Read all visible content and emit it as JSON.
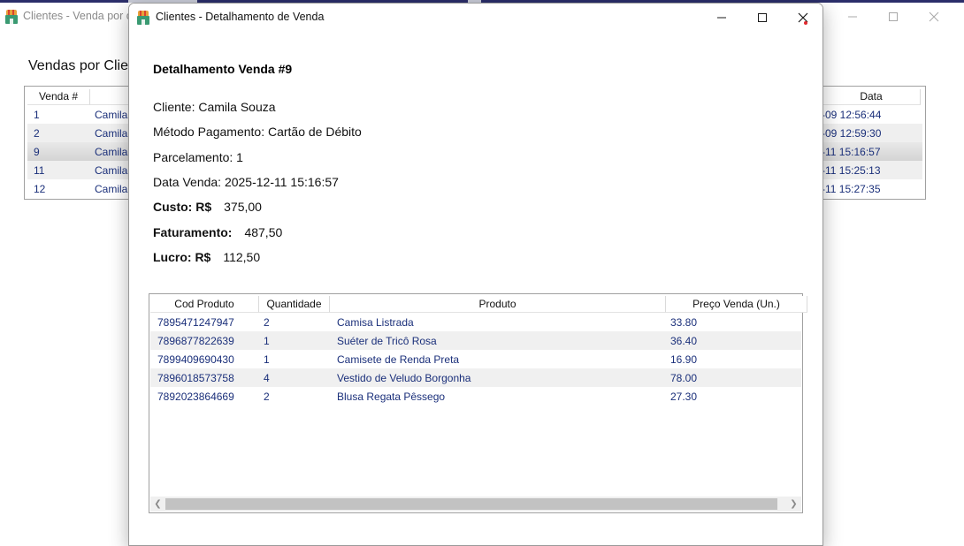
{
  "background_window": {
    "title": "Clientes - Venda por cl",
    "heading": "Vendas por Clier",
    "columns": [
      "Venda #",
      "Data"
    ],
    "rows": [
      {
        "id": "1",
        "client": "Camila",
        "date": "-09 12:56:44"
      },
      {
        "id": "2",
        "client": "Camila",
        "date": "-09 12:59:30"
      },
      {
        "id": "9",
        "client": "Camila",
        "date": "-11 15:16:57"
      },
      {
        "id": "11",
        "client": "Camila",
        "date": "-11 15:25:13"
      },
      {
        "id": "12",
        "client": "Camila",
        "date": "-11 15:27:35"
      }
    ],
    "selected_row": "9"
  },
  "dialog": {
    "title": "Clientes - Detalhamento de Venda",
    "heading": "Detalhamento Venda #9",
    "cliente": "Cliente: Camila Souza",
    "metodo": "Método Pagamento: Cartão de Débito",
    "parcelamento": "Parcelamento: 1",
    "data_venda": "Data Venda: 2025-12-11 15:16:57",
    "custo_label": "Custo: R$",
    "custo_value": "375,00",
    "faturamento_label": "Faturamento:",
    "faturamento_value": "487,50",
    "lucro_label": "Lucro: R$",
    "lucro_value": "112,50",
    "table": {
      "columns": [
        "Cod Produto",
        "Quantidade",
        "Produto",
        "Preço Venda (Un.)"
      ],
      "rows": [
        [
          "7895471247947",
          "2",
          "Camisa Listrada",
          "33.80"
        ],
        [
          "7896877822639",
          "1",
          "Suéter de Tricô Rosa",
          "36.40"
        ],
        [
          "7899409690430",
          "1",
          "Camisete de Renda Preta",
          "16.90"
        ],
        [
          "7896018573758",
          "4",
          "Vestido de Veludo Borgonha",
          "78.00"
        ],
        [
          "7892023864669",
          "2",
          "Blusa Regata Pêssego",
          "27.30"
        ]
      ]
    }
  },
  "colors": {
    "link_text": "#1a2f7a",
    "row_alt": "#f0f0f0",
    "close_dot": "#e0282e"
  }
}
